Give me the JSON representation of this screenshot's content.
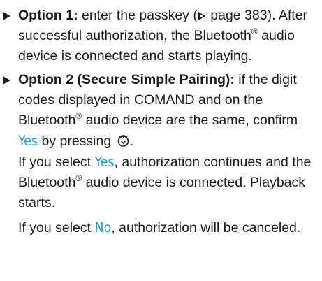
{
  "items": [
    {
      "bold": "Option 1:",
      "text1": " enter the passkey (",
      "page_ref": " page 383",
      "text2": "). After successful authorization, the Blue­tooth",
      "reg": "®",
      "text3": " audio device is connected and starts playing."
    },
    {
      "bold": "Option 2 (Secure Simple Pairing):",
      "text1": " if the digit codes displayed in COMAND and on the Bluetooth",
      "reg1": "®",
      "text2": " audio device are the same, confirm ",
      "yes1": "Yes",
      "text3": " by pressing ",
      "text4": ".",
      "p2_pre": "If you select ",
      "yes2": "Yes",
      "p2_mid": ", authorization continues and the Bluetooth",
      "reg2": "®",
      "p2_post": " audio device is connec­ted. Playback starts.",
      "p3_pre": "If you select ",
      "no": "No",
      "p3_post": ", authorization will be can­celed."
    }
  ],
  "icons": {
    "page_ref": "triangle-outline-icon",
    "press": "controller-press-icon",
    "bullet": "triangle-bullet-icon"
  },
  "colors": {
    "ui_text": "#1a9ed8",
    "text": "#1a1a1a"
  }
}
